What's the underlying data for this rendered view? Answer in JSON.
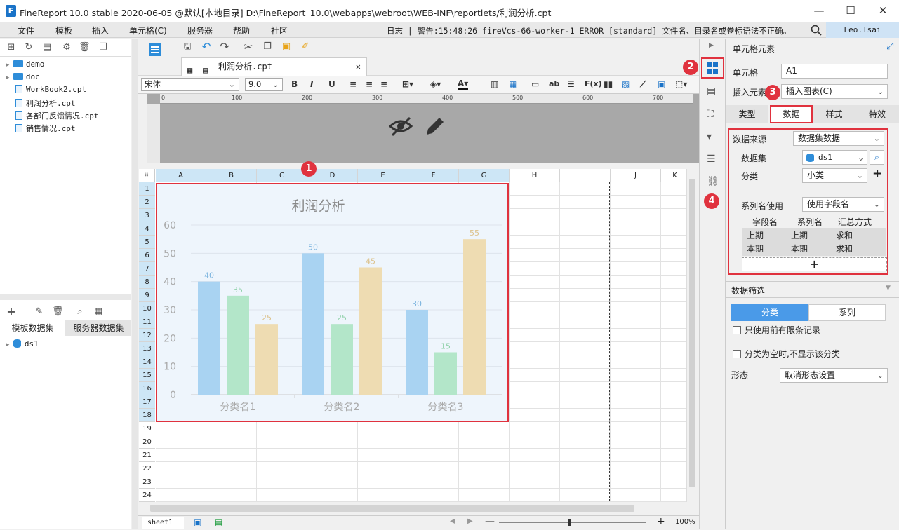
{
  "window": {
    "title": "FineReport 10.0 stable 2020-06-05 @默认[本地目录]    D:\\FineReport_10.0\\webapps\\webroot\\WEB-INF\\reportlets/利润分析.cpt",
    "minimize": "—",
    "maximize": "☐",
    "close": "✕"
  },
  "menu": [
    "文件",
    "模板",
    "插入",
    "单元格(C)",
    "服务器",
    "帮助",
    "社区"
  ],
  "log_label": "日志",
  "log_text": "警告:15:48:26 fireVcs-66-worker-1 ERROR [standard] 文件名、目录名或卷标语法不正确。",
  "user": "Leo.Tsai",
  "tree": [
    {
      "name": "demo",
      "type": "folder"
    },
    {
      "name": "doc",
      "type": "folder"
    },
    {
      "name": "WorkBook2.cpt",
      "type": "file"
    },
    {
      "name": "利润分析.cpt",
      "type": "file"
    },
    {
      "name": "各部门反馈情况.cpt",
      "type": "file"
    },
    {
      "name": "销售情况.cpt",
      "type": "file"
    }
  ],
  "dataset_tabs": [
    "模板数据集",
    "服务器数据集"
  ],
  "dataset_items": [
    "ds1"
  ],
  "doc_tab": "利润分析.cpt",
  "format": {
    "font": "宋体",
    "size": "9.0"
  },
  "ruler_ticks": [
    "0",
    "100",
    "200",
    "300",
    "400",
    "500",
    "600",
    "700"
  ],
  "columns": [
    "A",
    "B",
    "C",
    "D",
    "E",
    "F",
    "G",
    "H",
    "I",
    "J",
    "K"
  ],
  "rows": [
    "1",
    "2",
    "3",
    "4",
    "5",
    "6",
    "7",
    "8",
    "9",
    "10",
    "11",
    "12",
    "13",
    "14",
    "15",
    "16",
    "17",
    "18",
    "19",
    "20",
    "21",
    "22",
    "23",
    "24"
  ],
  "sheet_tab": "sheet1",
  "zoom": "100%",
  "badges": [
    "1",
    "2",
    "3",
    "4"
  ],
  "right": {
    "header": "单元格元素",
    "cell_label": "单元格",
    "cell_value": "A1",
    "insert_label": "插入元素",
    "insert_value": "插入图表(C)",
    "tabs": [
      "类型",
      "数据",
      "样式",
      "特效"
    ],
    "source_label": "数据来源",
    "source_value": "数据集数据",
    "dataset_label": "数据集",
    "dataset_value": "ds1",
    "category_label": "分类",
    "category_value": "小类",
    "series_use_label": "系列名使用",
    "series_use_value": "使用字段名",
    "field_headers": [
      "字段名",
      "系列名",
      "汇总方式"
    ],
    "field_rows": [
      [
        "上期",
        "上期",
        "求和"
      ],
      [
        "本期",
        "本期",
        "求和"
      ]
    ],
    "add": "+",
    "filter_title": "数据筛选",
    "filter_tabs": [
      "分类",
      "系列"
    ],
    "check1": "只使用前有限条记录",
    "check2": "分类为空时,不显示该分类",
    "shape_label": "形态",
    "shape_value": "取消形态设置"
  },
  "chart_data": {
    "type": "bar",
    "title": "利润分析",
    "categories": [
      "分类名1",
      "分类名2",
      "分类名3"
    ],
    "series": [
      {
        "values": [
          40,
          50,
          30
        ],
        "color": "#a9d3f2"
      },
      {
        "values": [
          35,
          25,
          15
        ],
        "color": "#b3e6c9"
      },
      {
        "values": [
          25,
          45,
          55
        ],
        "color": "#eedcb2"
      }
    ],
    "yticks": [
      0,
      10,
      20,
      30,
      40,
      50,
      60
    ],
    "ylim": [
      0,
      60
    ],
    "grid": true,
    "label_colors": [
      "#7ab3de",
      "#8ed0a8",
      "#dcc28c"
    ]
  },
  "colors": {
    "accent": "#e0323e",
    "blue": "#4a9ae8",
    "selected_col": "#cde6f6"
  }
}
